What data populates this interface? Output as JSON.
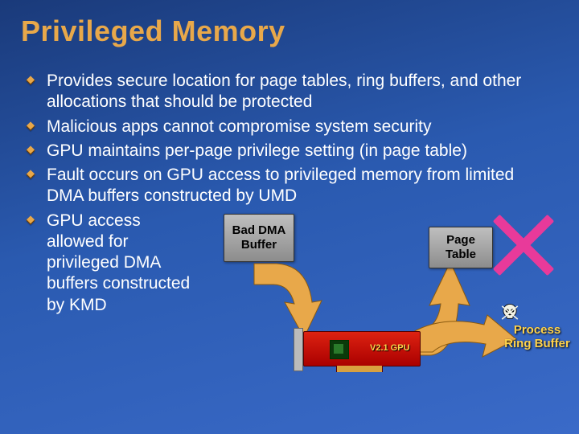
{
  "title": "Privileged Memory",
  "bullets": [
    "Provides secure location for page tables, ring buffers, and other allocations that should be protected",
    "Malicious apps cannot compromise system security",
    "GPU maintains per-page privilege setting (in page table)",
    "Fault occurs on GPU access to privileged memory from limited DMA buffers constructed by UMD",
    "GPU access allowed for privileged DMA buffers constructed by KMD"
  ],
  "diagram": {
    "bad_dma": "Bad\nDMA\nBuffer",
    "page_table": "Page\nTable",
    "process_ring": "Process\nRing\nBuffer",
    "gpu_label": "V2.1 GPU"
  }
}
